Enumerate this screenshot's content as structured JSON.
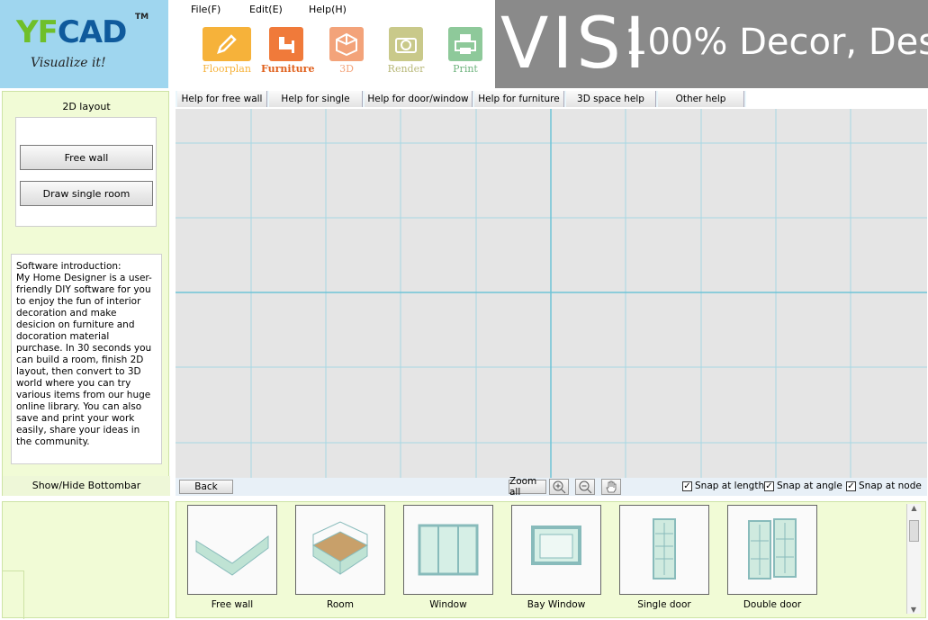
{
  "logo": {
    "brand_a": "YF",
    "brand_b": "CAD",
    "tm": "TM",
    "tagline": "Visualize it!"
  },
  "menu": [
    "File(F)",
    "Edit(E)",
    "Help(H)"
  ],
  "toolbar": [
    {
      "label": "Floorplan",
      "icon": "pencil-icon",
      "color": "#f6b23a"
    },
    {
      "label": "Furniture",
      "icon": "chair-icon",
      "color": "#f07a3a"
    },
    {
      "label": "3D",
      "icon": "cube-icon",
      "color": "#f3a37a"
    },
    {
      "label": "Render",
      "icon": "camera-icon",
      "color": "#c9c98a"
    },
    {
      "label": "Print",
      "icon": "printer-icon",
      "color": "#8ec99a"
    }
  ],
  "banner": {
    "visi": "VISI",
    "slogan": "100% Decor, Des"
  },
  "left": {
    "title": "2D layout",
    "buttons": [
      "Free wall",
      "Draw single room"
    ],
    "intro_title": "Software introduction:",
    "intro_text": "My Home Designer is a user-friendly DIY software for you to enjoy the fun of interior decoration and make desicion on furniture and docoration material purchase. In 30 seconds you can build a room, finish 2D layout, then convert to 3D world where you can try various items from our huge online library. You can also save and print your work easily, share your ideas in the community.",
    "showhide": "Show/Hide Bottombar"
  },
  "help_tabs": [
    "Help for free wall",
    "Help for single room",
    "Help for door/window",
    "Help for furniture",
    "3D space help",
    "Other help"
  ],
  "canvas_bar": {
    "back": "Back",
    "zoom_all": "Zoom all",
    "snaps": [
      {
        "label": "Snap at length",
        "checked": true
      },
      {
        "label": "Snap at angle",
        "checked": true
      },
      {
        "label": "Snap at node",
        "checked": true
      }
    ],
    "check_mark": "✓"
  },
  "items": [
    "Free wall",
    "Room",
    "Window",
    "Bay Window",
    "Single door",
    "Double door"
  ],
  "colors": {
    "grid": "#9cd3e0",
    "panel": "#f1fbd6",
    "logo_bg": "#9fd6ef"
  }
}
